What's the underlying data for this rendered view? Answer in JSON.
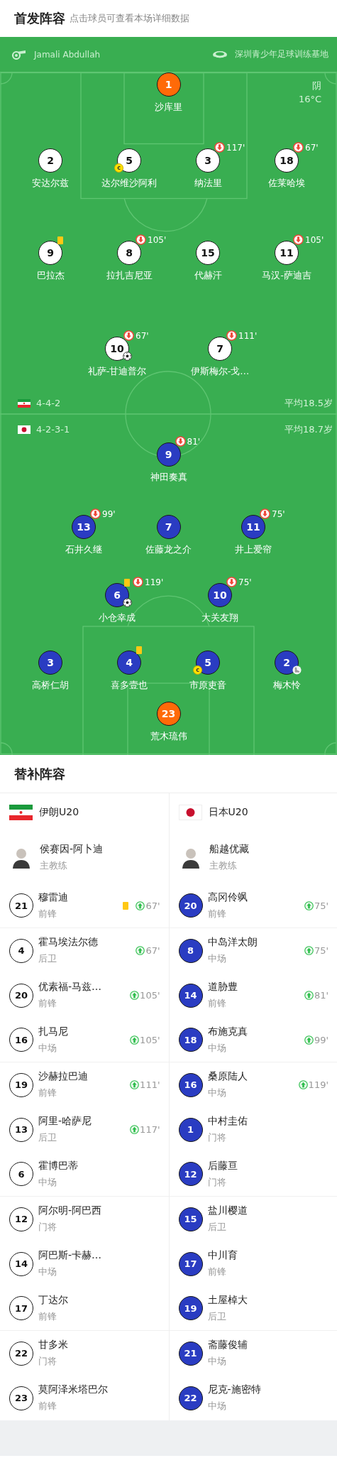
{
  "header": {
    "title": "首发阵容",
    "hint": "点击球员可查看本场详细数据"
  },
  "match": {
    "referee": "Jamali Abdullah",
    "venue": "深圳青少年足球训练基地",
    "weather": "阴",
    "temperature": "16°C"
  },
  "home": {
    "flag": {
      "kind": "iran"
    },
    "formation": "4-4-2",
    "average_age": "平均18.5岁",
    "lines": [
      [
        {
          "number": "1",
          "name": "沙库里"
        }
      ],
      [
        {
          "number": "2",
          "name": "安达尔兹"
        },
        {
          "number": "5",
          "name": "达尔维沙阿利",
          "events": [
            {
              "kind": "captain",
              "label": "c"
            }
          ]
        },
        {
          "number": "3",
          "name": "纳法里",
          "sub_out": "117'"
        },
        {
          "number": "18",
          "name": "佐莱哈埃",
          "sub_out": "67'"
        }
      ],
      [
        {
          "number": "9",
          "name": "巴拉杰",
          "events": [
            {
              "kind": "yellow_card"
            }
          ]
        },
        {
          "number": "8",
          "name": "拉扎吉尼亚",
          "sub_out": "105'"
        },
        {
          "number": "15",
          "name": "代赫汗"
        },
        {
          "number": "11",
          "name": "马汉-萨迪吉",
          "sub_out": "105'"
        }
      ],
      [
        {
          "number": "10",
          "name": "礼萨-甘迪普尔",
          "sub_out": "67'",
          "events": [
            {
              "kind": "goal"
            }
          ]
        },
        {
          "number": "7",
          "name": "伊斯梅尔-戈…",
          "sub_out": "111'"
        }
      ]
    ]
  },
  "away": {
    "flag": {
      "kind": "japan"
    },
    "formation": "4-2-3-1",
    "average_age": "平均18.7岁",
    "lines": [
      [
        {
          "number": "9",
          "name": "神田奏真",
          "sub_out": "81'"
        }
      ],
      [
        {
          "number": "13",
          "name": "石井久继",
          "sub_out": "99'"
        },
        {
          "number": "7",
          "name": "佐藤龙之介"
        },
        {
          "number": "11",
          "name": "井上爱帘",
          "sub_out": "75'"
        }
      ],
      [
        {
          "number": "6",
          "name": "小仓幸成",
          "sub_out": "119'",
          "events": [
            {
              "kind": "yellow_card"
            },
            {
              "kind": "goal"
            }
          ]
        },
        {
          "number": "10",
          "name": "大关友翔",
          "sub_out": "75'"
        }
      ],
      [
        {
          "number": "3",
          "name": "高桥仁胡"
        },
        {
          "number": "4",
          "name": "喜多壹也",
          "events": [
            {
              "kind": "yellow_card"
            }
          ]
        },
        {
          "number": "5",
          "name": "市原吏音",
          "events": [
            {
              "kind": "captain",
              "label": "c"
            }
          ]
        },
        {
          "number": "2",
          "name": "梅木怜",
          "events": [
            {
              "kind": "assist"
            }
          ]
        }
      ],
      [
        {
          "number": "23",
          "name": "荒木琉伟"
        }
      ]
    ]
  },
  "substitutes": {
    "title": "替补阵容",
    "teams": [
      {
        "name": "伊朗U20",
        "flag": {
          "kind": "iran"
        },
        "coach": "侯赛因-阿卜迪",
        "coach_role": "主教练",
        "players": [
          {
            "number": "21",
            "name": "穆雷迪",
            "position": "前锋",
            "sub_in": "67'",
            "events": [
              {
                "kind": "yellow_card"
              }
            ]
          },
          {
            "number": "4",
            "name": "霍马埃法尔德",
            "position": "后卫",
            "sub_in": "67'"
          },
          {
            "number": "20",
            "name": "优素福-马兹…",
            "position": "前锋",
            "sub_in": "105'"
          },
          {
            "number": "16",
            "name": "扎马尼",
            "position": "中场",
            "sub_in": "105'"
          },
          {
            "number": "19",
            "name": "沙赫拉巴迪",
            "position": "前锋",
            "sub_in": "111'"
          },
          {
            "number": "13",
            "name": "阿里-哈萨尼",
            "position": "后卫",
            "sub_in": "117'"
          },
          {
            "number": "6",
            "name": "霍博巴蒂",
            "position": "中场"
          },
          {
            "number": "12",
            "name": "阿尔明-阿巴西",
            "position": "门将"
          },
          {
            "number": "14",
            "name": "阿巴斯-卡赫…",
            "position": "中场"
          },
          {
            "number": "17",
            "name": "丁达尔",
            "position": "前锋"
          },
          {
            "number": "22",
            "name": "甘多米",
            "position": "门将"
          },
          {
            "number": "23",
            "name": "莫阿泽米塔巴尔",
            "position": "前锋"
          }
        ]
      },
      {
        "name": "日本U20",
        "flag": {
          "kind": "japan"
        },
        "coach": "船越优藏",
        "coach_role": "主教练",
        "players": [
          {
            "number": "20",
            "name": "高冈伶飒",
            "position": "前锋",
            "sub_in": "75'"
          },
          {
            "number": "8",
            "name": "中岛洋太朗",
            "position": "中场",
            "sub_in": "75'"
          },
          {
            "number": "14",
            "name": "道胁豊",
            "position": "前锋",
            "sub_in": "81'"
          },
          {
            "number": "18",
            "name": "布施克真",
            "position": "中场",
            "sub_in": "99'"
          },
          {
            "number": "16",
            "name": "桑原陆人",
            "position": "中场",
            "sub_in": "119'"
          },
          {
            "number": "1",
            "name": "中村圭佑",
            "position": "门将"
          },
          {
            "number": "12",
            "name": "后藤亘",
            "position": "门将"
          },
          {
            "number": "15",
            "name": "盐川樱道",
            "position": "后卫"
          },
          {
            "number": "17",
            "name": "中川育",
            "position": "前锋"
          },
          {
            "number": "19",
            "name": "土屋棹大",
            "position": "后卫"
          },
          {
            "number": "21",
            "name": "斋藤俊辅",
            "position": "中场"
          },
          {
            "number": "22",
            "name": "尼克-施密特",
            "position": "中场"
          }
        ]
      }
    ]
  }
}
